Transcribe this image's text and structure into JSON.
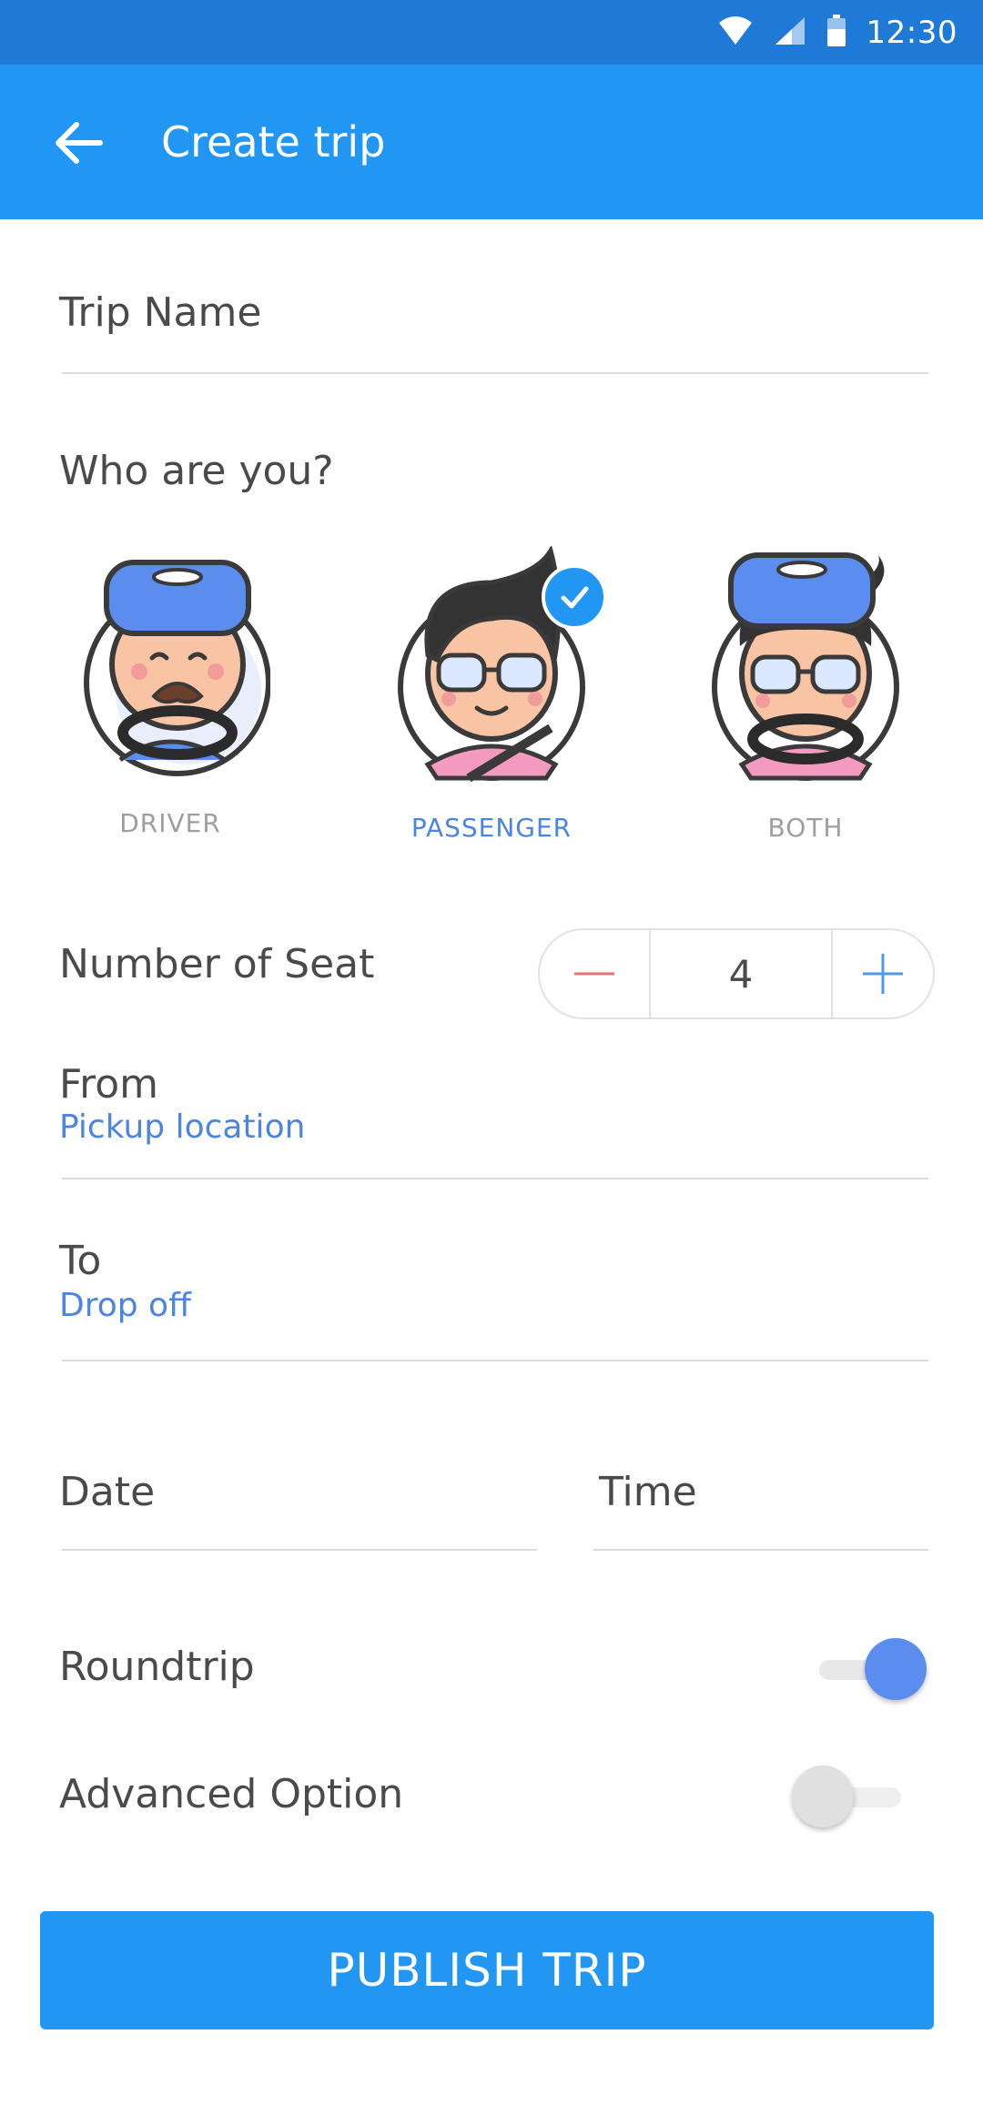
{
  "status_bar": {
    "time": "12:30",
    "icons": [
      "wifi-icon",
      "signal-icon",
      "battery-icon"
    ]
  },
  "app_bar": {
    "title": "Create trip",
    "back_icon": "arrow-left-icon"
  },
  "form": {
    "trip_name_label": "Trip Name",
    "who_label": "Who are you?",
    "roles": [
      {
        "label": "DRIVER",
        "selected": false
      },
      {
        "label": "PASSENGER",
        "selected": true
      },
      {
        "label": "BOTH",
        "selected": false
      }
    ],
    "seats_label": "Number of Seat",
    "seats_value": "4",
    "from_label": "From",
    "from_placeholder": "Pickup location",
    "to_label": "To",
    "to_placeholder": "Drop off",
    "date_label": "Date",
    "time_label": "Time",
    "roundtrip_label": "Roundtrip",
    "roundtrip_on": true,
    "advanced_label": "Advanced Option",
    "advanced_on": false,
    "publish_label": "PUBLISH TRIP"
  },
  "colors": {
    "status_bar": "#1e7ad6",
    "primary": "#2196f3",
    "accent_text": "#4c85e0",
    "toggle_on": "#5b8def",
    "minus": "#e57373"
  }
}
